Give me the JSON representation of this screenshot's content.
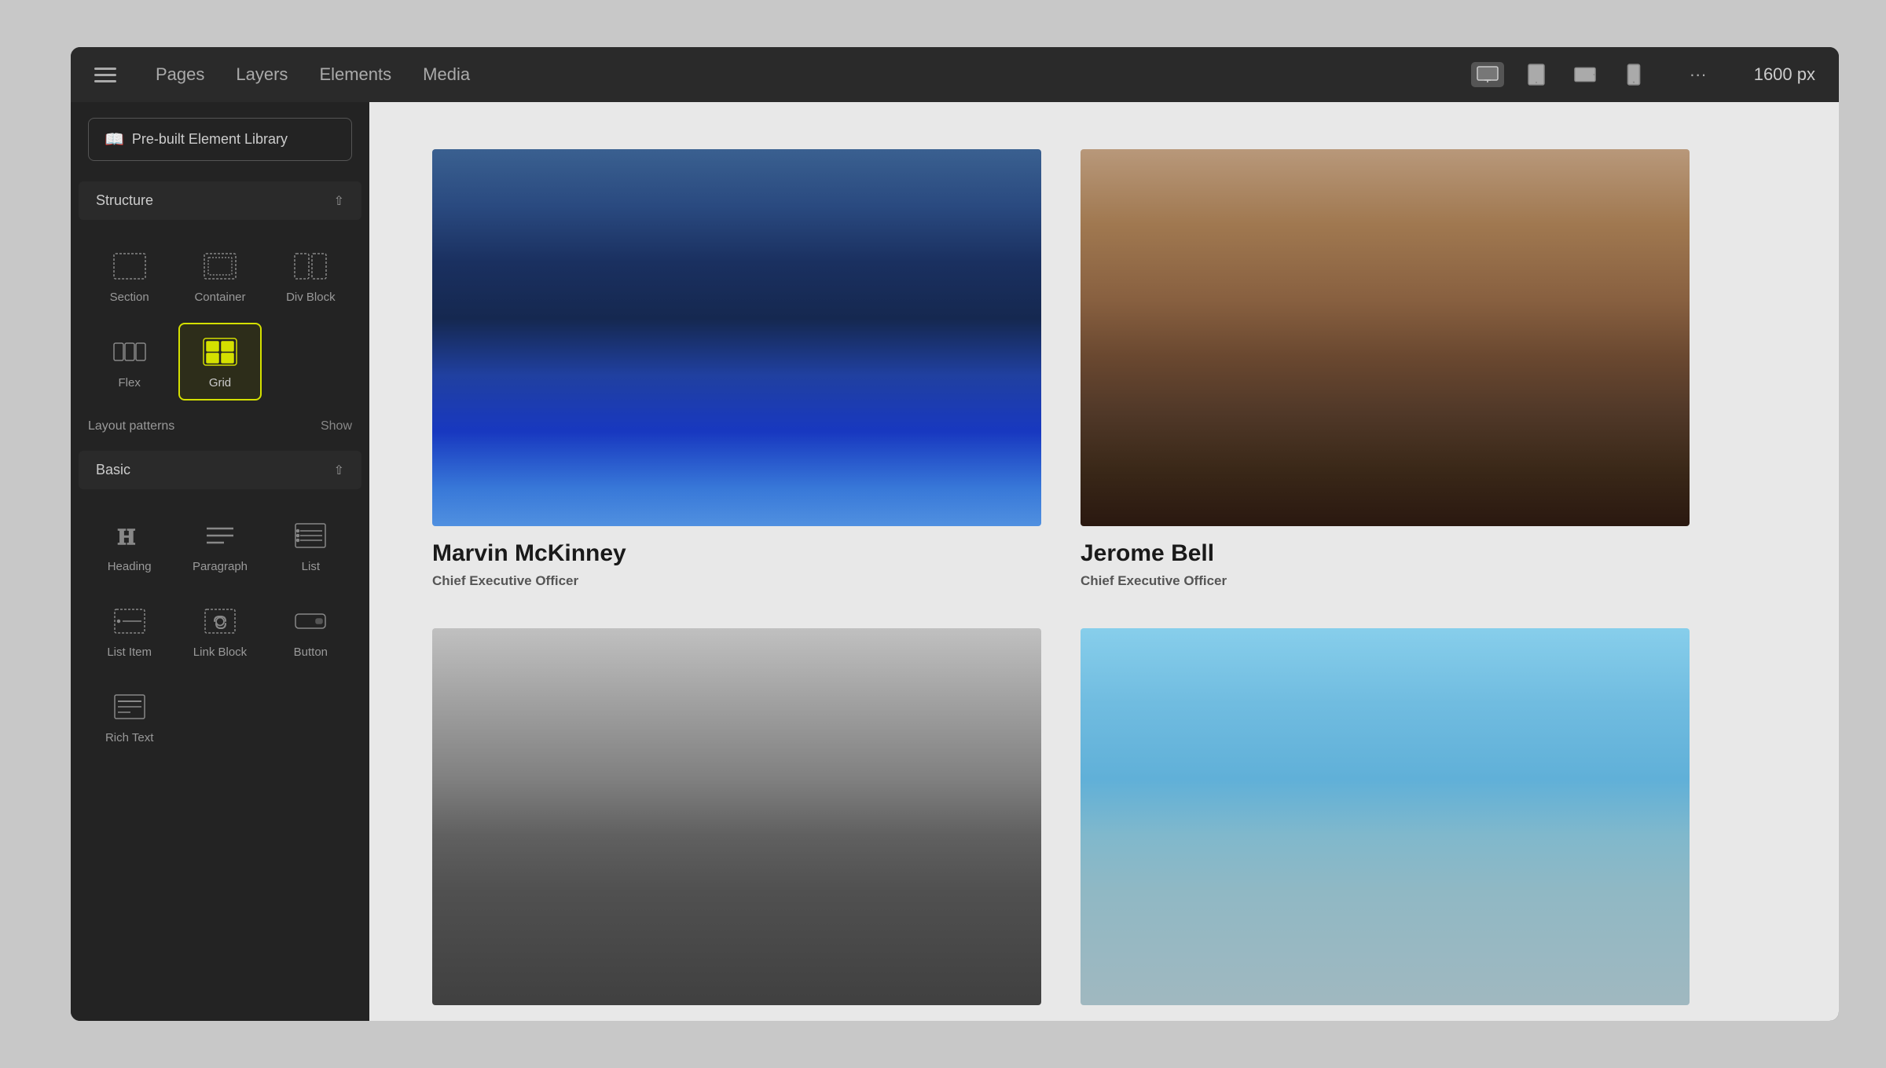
{
  "topbar": {
    "nav_items": [
      "Pages",
      "Layers",
      "Elements",
      "Media"
    ],
    "width_label": "1600 px",
    "dots_label": "···"
  },
  "sidebar": {
    "library_btn_label": "Pre-built Element Library",
    "structure_section": {
      "title": "Structure",
      "items": [
        {
          "id": "section",
          "label": "Section",
          "icon": "section"
        },
        {
          "id": "container",
          "label": "Container",
          "icon": "container"
        },
        {
          "id": "div-block",
          "label": "Div Block",
          "icon": "div-block"
        },
        {
          "id": "flex",
          "label": "Flex",
          "icon": "flex"
        },
        {
          "id": "grid",
          "label": "Grid",
          "icon": "grid",
          "active": true
        }
      ],
      "layout_patterns_label": "Layout patterns",
      "layout_patterns_show": "Show"
    },
    "basic_section": {
      "title": "Basic",
      "items": [
        {
          "id": "heading",
          "label": "Heading",
          "icon": "heading"
        },
        {
          "id": "paragraph",
          "label": "Paragraph",
          "icon": "paragraph"
        },
        {
          "id": "list",
          "label": "List",
          "icon": "list"
        },
        {
          "id": "list-item",
          "label": "List Item",
          "icon": "list-item"
        },
        {
          "id": "link-block",
          "label": "Link Block",
          "icon": "link-block"
        },
        {
          "id": "button",
          "label": "Button",
          "icon": "button"
        },
        {
          "id": "rich-text",
          "label": "Rich Text",
          "icon": "rich-text"
        }
      ]
    }
  },
  "canvas": {
    "team_members": [
      {
        "id": "marvin",
        "name": "Marvin McKinney",
        "title": "Chief Executive Officer",
        "photo_style": "marvin"
      },
      {
        "id": "jerome",
        "name": "Jerome Bell",
        "title": "Chief Executive Officer",
        "photo_style": "jerome"
      },
      {
        "id": "person3",
        "name": "",
        "title": "",
        "photo_style": "grayscale"
      },
      {
        "id": "person4",
        "name": "",
        "title": "",
        "photo_style": "outdoor"
      }
    ]
  }
}
